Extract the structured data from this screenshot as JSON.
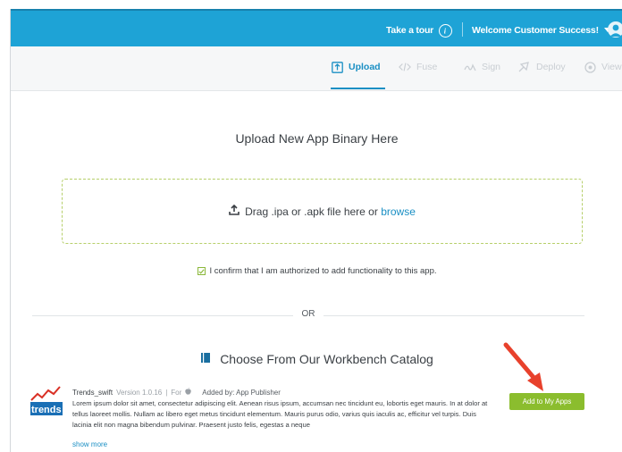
{
  "header": {
    "tour_label": "Take a tour",
    "welcome_label": "Welcome Customer Success!",
    "colors": {
      "bar": "#1ea3d6",
      "accent": "#1a8fc4",
      "success": "#8bbd2e"
    }
  },
  "steps": [
    {
      "label": "Upload",
      "icon": "upload-box-icon",
      "active": true
    },
    {
      "label": "Fuse",
      "icon": "code-icon",
      "active": false
    },
    {
      "label": "Sign",
      "icon": "signature-icon",
      "active": false
    },
    {
      "label": "Deploy",
      "icon": "deploy-icon",
      "active": false
    },
    {
      "label": "View",
      "icon": "view-icon",
      "active": false
    }
  ],
  "upload": {
    "title": "Upload New App Binary Here",
    "drop_text": "Drag .ipa or .apk file here or ",
    "browse_label": "browse",
    "confirm_text": "I confirm that I am authorized to add functionality to this app."
  },
  "or_label": "OR",
  "catalog": {
    "title": "Choose From Our Workbench Catalog",
    "app": {
      "name": "Trends_swift",
      "version": "Version 1.0.16",
      "separator": "|",
      "for_label": "For",
      "added_by": "Added by: App Publisher",
      "logo_text": "trends",
      "description": "Lorem ipsum dolor sit amet, consectetur adipiscing elit. Aenean risus ipsum, accumsan nec tincidunt eu, lobortis eget mauris. In at dolor at tellus laoreet mollis. Nullam ac libero eget metus tincidunt elementum. Mauris purus odio, varius quis iaculis ac, efficitur vel turpis. Duis lacinia elit non magna bibendum pulvinar. Praesent justo felis, egestas a neque",
      "show_more": "show more",
      "add_button": "Add to My Apps"
    }
  }
}
